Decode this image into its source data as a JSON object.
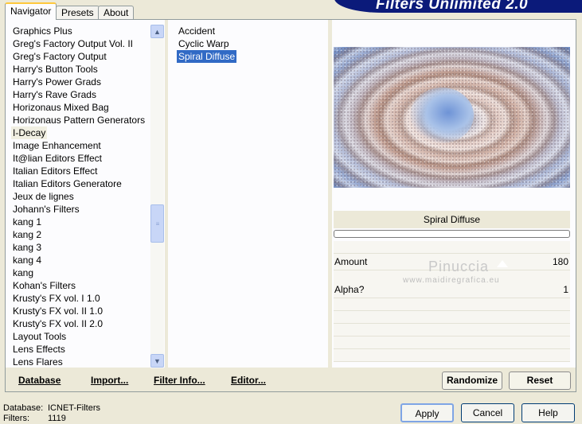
{
  "app": {
    "title": "Filters Unlimited 2.0"
  },
  "tabs": [
    {
      "label": "Navigator",
      "active": true
    },
    {
      "label": "Presets",
      "active": false
    },
    {
      "label": "About",
      "active": false
    }
  ],
  "categories": [
    "Graphics Plus",
    "Greg's Factory Output Vol. II",
    "Greg's Factory Output",
    "Harry's Button Tools",
    "Harry's Power Grads",
    "Harry's Rave Grads",
    "Horizonaus Mixed Bag",
    "Horizonaus Pattern Generators",
    "I-Decay",
    "Image Enhancement",
    "It@lian Editors Effect",
    "Italian Editors Effect",
    "Italian Editors Generatore",
    "Jeux de lignes",
    "Johann's Filters",
    "kang 1",
    "kang 2",
    "kang 3",
    "kang 4",
    "kang",
    "Kohan's Filters",
    "Krusty's FX vol. I 1.0",
    "Krusty's FX vol. II 1.0",
    "Krusty's FX vol. II 2.0",
    "Layout Tools",
    "Lens Effects",
    "Lens Flares"
  ],
  "selected_category": "I-Decay",
  "filters": [
    "Accident",
    "Cyclic Warp",
    "Spiral Diffuse"
  ],
  "selected_filter": "Spiral Diffuse",
  "params": {
    "title": "Spiral Diffuse",
    "rows": [
      {
        "label": "Amount",
        "value": "180"
      },
      {
        "label": "Alpha?",
        "value": "1"
      }
    ]
  },
  "watermark": {
    "line1": "Pinuccia",
    "line2": "www.maidiregrafica.eu"
  },
  "toolbar": {
    "database": "Database",
    "import": "Import...",
    "filter_info": "Filter Info...",
    "editor": "Editor...",
    "randomize": "Randomize",
    "reset": "Reset"
  },
  "status": {
    "database_label": "Database:",
    "database_value": "ICNET-Filters",
    "filters_label": "Filters:",
    "filters_value": "1119"
  },
  "dialog": {
    "apply": "Apply",
    "cancel": "Cancel",
    "help": "Help"
  }
}
